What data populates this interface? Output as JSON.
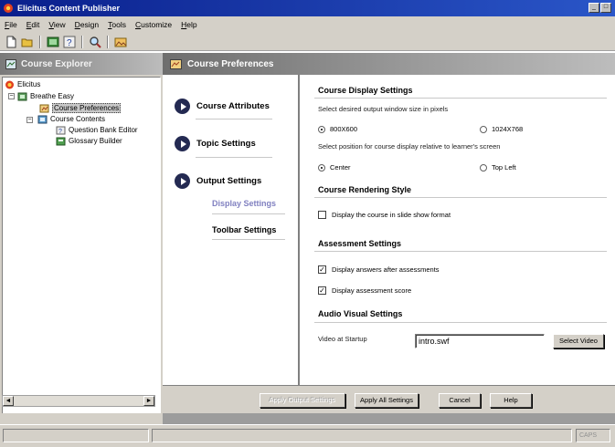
{
  "window": {
    "title": "Elicitus Content Publisher",
    "buttons": [
      "_",
      "□"
    ]
  },
  "menu": [
    "File",
    "Edit",
    "View",
    "Design",
    "Tools",
    "Customize",
    "Help"
  ],
  "toolbar": {
    "icons": [
      "new-doc-icon",
      "open-folder-icon",
      "preview-icon",
      "question-icon",
      "search-icon",
      "gallery-icon"
    ]
  },
  "explorer": {
    "title": "Course Explorer",
    "tree": {
      "root": "Elicitus",
      "course": "Breathe Easy",
      "preferences": "Course Preferences",
      "contents": "Course Contents",
      "question_bank": "Question Bank Editor",
      "glossary": "Glossary Builder"
    },
    "scroll_left": "◄",
    "scroll_right": "►"
  },
  "panel": {
    "title": "Course Preferences"
  },
  "nav": {
    "course_attributes": "Course Attributes",
    "topic_settings": "Topic Settings",
    "output_settings": "Output Settings",
    "display_settings": "Display Settings",
    "toolbar_settings": "Toolbar Settings",
    "active_color": "#8080c0"
  },
  "display": {
    "section_title": "Course Display Settings",
    "size_prompt": "Select desired output window size in pixels",
    "size_options": [
      "800X600",
      "1024X768"
    ],
    "size_selected": "800X600",
    "position_prompt": "Select position for course display relative to learner's screen",
    "position_options": [
      "Center",
      "Top Left"
    ],
    "position_selected": "Center"
  },
  "rendering": {
    "section_title": "Course Rendering Style",
    "slide_show_label": "Display the course in slide show format",
    "slide_show_checked": false
  },
  "assessment": {
    "section_title": "Assessment Settings",
    "answers_label": "Display answers after assessments",
    "answers_checked": true,
    "score_label": "Display assessment score",
    "score_checked": true
  },
  "audio_visual": {
    "section_title": "Audio Visual Settings",
    "video_label": "Video at Startup",
    "video_value": "intro.swf",
    "select_button": "Select Video"
  },
  "actions": {
    "apply_output": "Apply Output Settings",
    "apply_all": "Apply All Settings",
    "cancel": "Cancel",
    "help": "Help"
  },
  "status": {
    "caps": "CAPS"
  }
}
